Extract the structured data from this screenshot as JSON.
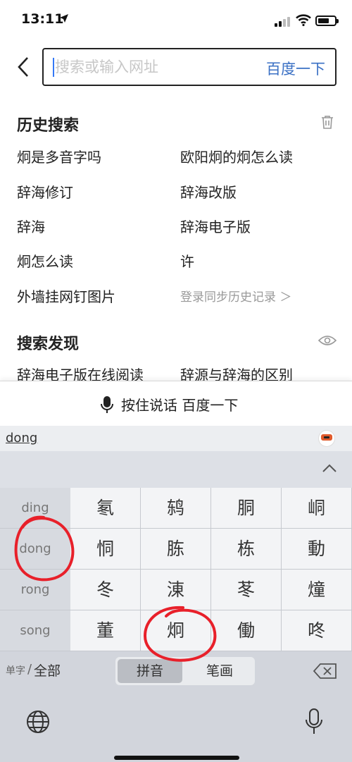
{
  "status_bar": {
    "time": "13:11",
    "battery_level": 0.7,
    "signal_bars": 2
  },
  "search": {
    "placeholder": "搜索或输入网址",
    "submit_label": "百度一下"
  },
  "history": {
    "title": "历史搜索",
    "items": [
      "炯是多音字吗",
      "欧阳炯的炯怎么读",
      "辞海修订",
      "辞海改版",
      "辞海",
      "辞海电子版",
      "炯怎么读",
      "许",
      "外墙挂网钉图片"
    ],
    "login_sync": "登录同步历史记录 ＞"
  },
  "discover": {
    "title": "搜索发现",
    "items": [
      "辞海电子版在线阅读",
      "辞源与辞海的区别"
    ]
  },
  "voice_bar": {
    "label": "按住说话 百度一下"
  },
  "keyboard": {
    "composition": "dong",
    "pinyin_options": [
      "ding",
      "dong",
      "rong",
      "song"
    ],
    "candidates": [
      [
        "氡",
        "鸫",
        "胴",
        "峒"
      ],
      [
        "恫",
        "胨",
        "栋",
        "動"
      ],
      [
        "冬",
        "涷",
        "苳",
        "燑"
      ],
      [
        "董",
        "炯",
        "働",
        "咚"
      ]
    ],
    "danzi_label": "单字",
    "separator": "/",
    "all_label": "全部",
    "modes": [
      "拼音",
      "笔画"
    ],
    "active_mode": "拼音"
  },
  "annotation_color": "#e8202a",
  "accent_color": "#3a70c4"
}
